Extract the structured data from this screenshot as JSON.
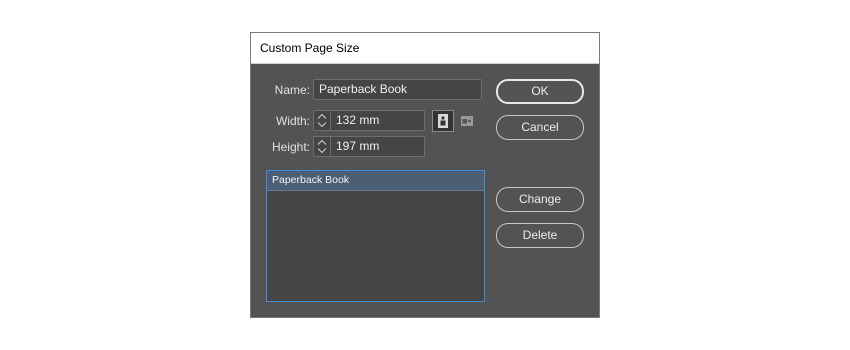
{
  "dialog": {
    "title": "Custom Page Size",
    "name_label": "Name:",
    "name_value": "Paperback Book",
    "width_label": "Width:",
    "width_value": "132 mm",
    "height_label": "Height:",
    "height_value": "197 mm",
    "orientation": {
      "selected": "portrait",
      "icons": [
        "portrait-orientation-icon",
        "landscape-orientation-icon"
      ]
    },
    "list": {
      "items": [
        "Paperback Book"
      ],
      "selected_index": 0
    },
    "buttons": {
      "ok": "OK",
      "cancel": "Cancel",
      "change": "Change",
      "delete": "Delete"
    },
    "colors": {
      "dialog_bg": "#535353",
      "field_bg": "#454545",
      "focus_border": "#3b8fd9",
      "selection_bg": "#4b5e73"
    }
  }
}
